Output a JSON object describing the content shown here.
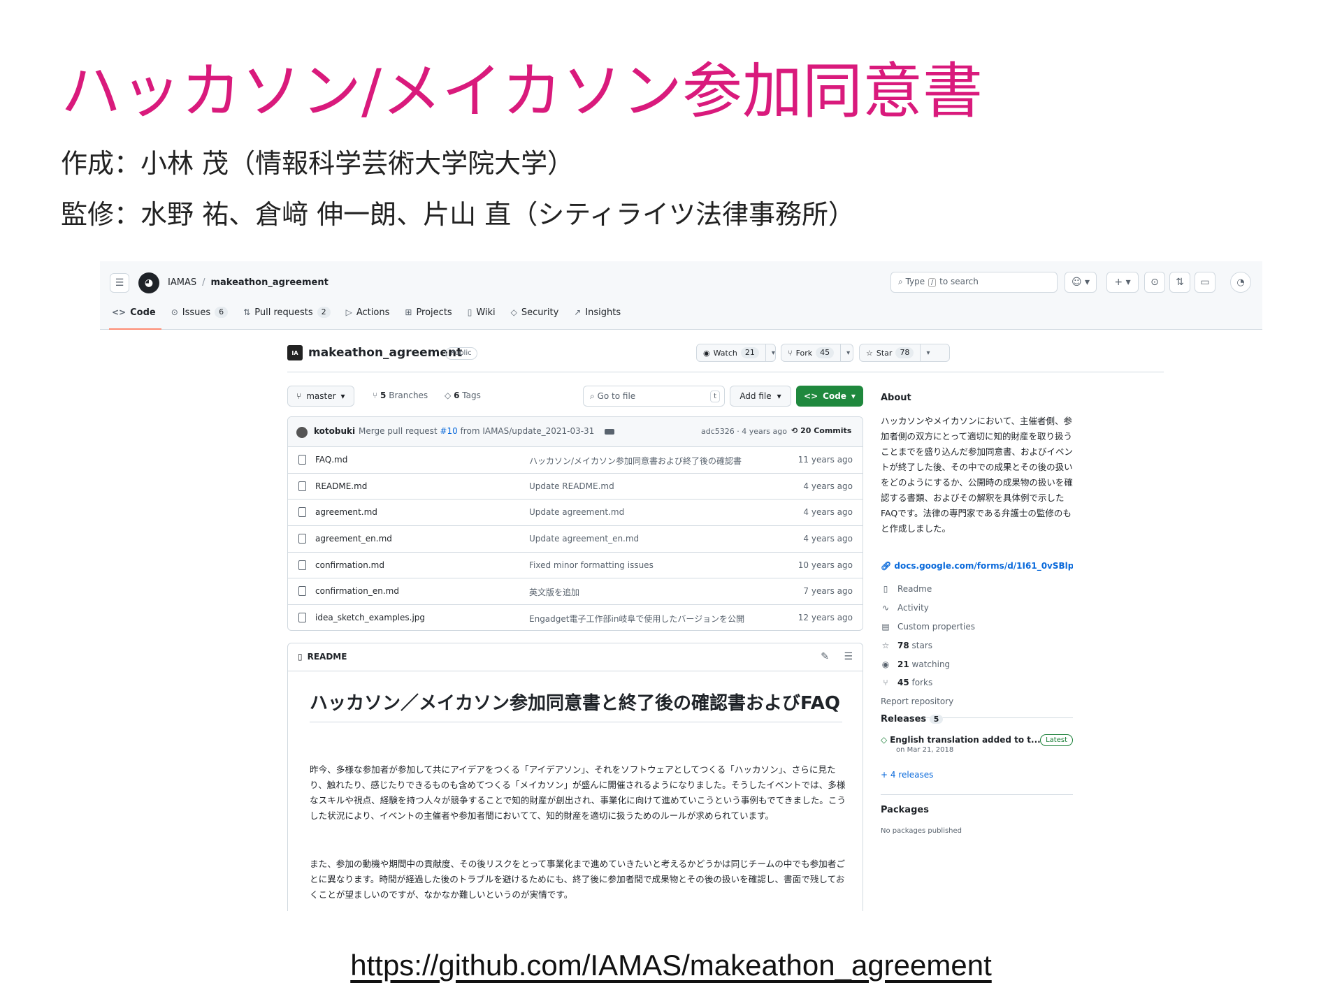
{
  "slide": {
    "title": "ハッカソン/メイカソン参加同意書",
    "author_line": "作成：小林 茂（情報科学芸術大学院大学）",
    "supervisor_line": "監修：水野 祐、倉﨑 伸一朗、片山 直（シティライツ法律事務所）",
    "url": "https://github.com/IAMAS/makeathon_agreement"
  },
  "header": {
    "owner": "IAMAS",
    "separator": "/",
    "repo": "makeathon_agreement",
    "search_prefix": "Type",
    "search_key": "/",
    "search_suffix": "to search"
  },
  "tabs": [
    {
      "label": "Code",
      "icon": "code-icon"
    },
    {
      "label": "Issues",
      "count": "6",
      "icon": "issue-icon"
    },
    {
      "label": "Pull requests",
      "count": "2",
      "icon": "pull-request-icon"
    },
    {
      "label": "Actions",
      "icon": "play-icon"
    },
    {
      "label": "Projects",
      "icon": "table-icon"
    },
    {
      "label": "Wiki",
      "icon": "book-icon"
    },
    {
      "label": "Security",
      "icon": "shield-icon"
    },
    {
      "label": "Insights",
      "icon": "graph-icon"
    }
  ],
  "repo": {
    "name": "makeathon_agreement",
    "visibility": "Public",
    "watch_label": "Watch",
    "watch_count": "21",
    "fork_label": "Fork",
    "fork_count": "45",
    "star_label": "Star",
    "star_count": "78"
  },
  "toolbar": {
    "branch": "master",
    "branches_count": "5",
    "branches_label": "Branches",
    "tags_count": "6",
    "tags_label": "Tags",
    "go_to_file": "Go to file",
    "go_to_file_key": "t",
    "add_file": "Add file",
    "code": "Code"
  },
  "commit": {
    "author": "kotobuki",
    "message_prefix": "Merge pull request",
    "pr_link": "#10",
    "message_suffix": "from IAMAS/update_2021-03-31",
    "sha_time": "adc5326 · 4 years ago",
    "commits": "20 Commits"
  },
  "files": [
    {
      "name": "FAQ.md",
      "message": "ハッカソン/メイカソン参加同意書および終了後の確認書",
      "time": "11 years ago"
    },
    {
      "name": "README.md",
      "message": "Update README.md",
      "time": "4 years ago"
    },
    {
      "name": "agreement.md",
      "message": "Update agreement.md",
      "time": "4 years ago"
    },
    {
      "name": "agreement_en.md",
      "message": "Update agreement_en.md",
      "time": "4 years ago"
    },
    {
      "name": "confirmation.md",
      "message": "Fixed minor formatting issues",
      "time": "10 years ago"
    },
    {
      "name": "confirmation_en.md",
      "message": "英文版を追加",
      "time": "7 years ago"
    },
    {
      "name": "idea_sketch_examples.jpg",
      "message": "Engadget電子工作部in岐阜で使用したバージョンを公開",
      "time": "12 years ago"
    }
  ],
  "readme": {
    "label": "README",
    "title": "ハッカソン／メイカソン参加同意書と終了後の確認書およびFAQ",
    "p1": "昨今、多様な参加者が参加して共にアイデアをつくる「アイデアソン」、それをソフトウェアとしてつくる「ハッカソン」、さらに見たり、触れたり、感じたりできるものも含めてつくる「メイカソン」が盛んに開催されるようになりました。そうしたイベントでは、多様なスキルや視点、経験を持つ人々が競争することで知的財産が創出され、事業化に向けて進めていこうという事例もでてきました。こうした状況により、イベントの主催者や参加者間においてて、知的財産を適切に扱うためのルールが求められています。",
    "p2": "また、参加の動機や期間中の貢献度、その後リスクをとって事業化まで進めていきたいと考えるかどうかは同じチームの中でも参加者ごとに異なります。時間が経過した後のトラブルを避けるためにも、終了後に参加者間で成果物とその後の扱いを確認し、書面で残しておくことが望ましいのですが、なかなか難しいというのが実情です。"
  },
  "about": {
    "heading": "About",
    "description": "ハッカソンやメイカソンにおいて、主催者側、参加者側の双方にとって適切に知的財産を取り扱うことまでを盛り込んだ参加同意書、およびイベントが終了した後、その中での成果とその後の扱いをどのようにするか、公開時の成果物の扱いを確認する書類、およびその解釈を具体例で示したFAQです。法律の専門家である弁護士の監修のもと作成しました。",
    "link": "docs.google.com/forms/d/1I61_0vSBlp...",
    "items": [
      {
        "icon": "book-icon",
        "label": "Readme"
      },
      {
        "icon": "pulse-icon",
        "label": "Activity"
      },
      {
        "icon": "note-icon",
        "label": "Custom properties"
      },
      {
        "icon": "star-icon",
        "count": "78",
        "label": "stars"
      },
      {
        "icon": "eye-icon",
        "count": "21",
        "label": "watching"
      },
      {
        "icon": "fork-icon",
        "count": "45",
        "label": "forks"
      }
    ],
    "report": "Report repository"
  },
  "releases": {
    "heading": "Releases",
    "count": "5",
    "latest_title": "English translation added to t...",
    "latest_badge": "Latest",
    "latest_date": "on Mar 21, 2018",
    "more": "+ 4 releases"
  },
  "packages": {
    "heading": "Packages",
    "empty": "No packages published"
  },
  "colors": {
    "title": "#d91a7c",
    "code_button": "#1f883d",
    "link": "#0969da",
    "active_tab": "#fd8c73"
  }
}
